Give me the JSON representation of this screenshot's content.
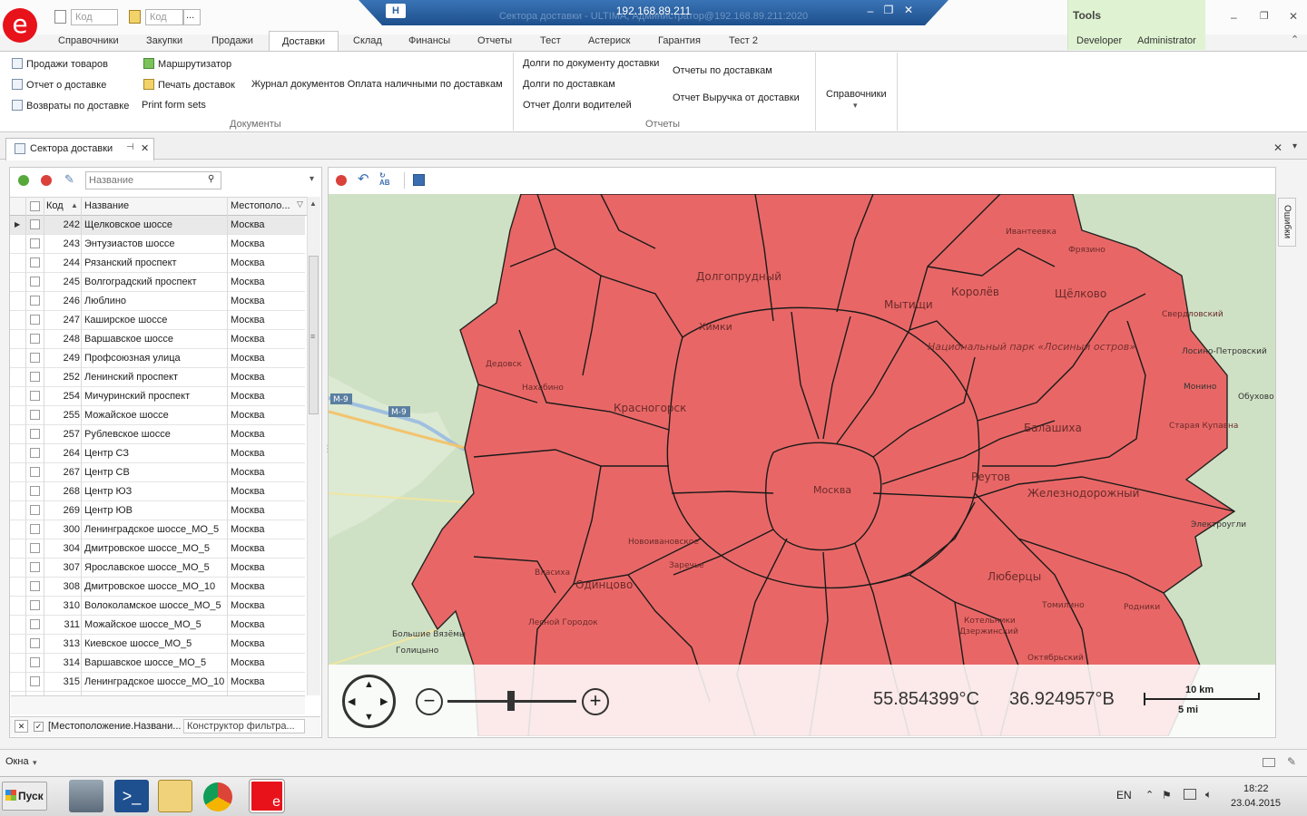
{
  "app": {
    "logo_letter": "e",
    "title_ip": "192.168.89.211",
    "title_full": "Сектора доставки - ULTIMA, Администратор@192.168.89.211:2020",
    "quick_code_1": "Код",
    "quick_code_2": "Код",
    "quick_more": "...",
    "accent_color": "#e8121b",
    "title_bar_color": "#2a62a3"
  },
  "tabs": [
    "Справочники",
    "Закупки",
    "Продажи",
    "Доставки",
    "Склад",
    "Финансы",
    "Отчеты",
    "Тест",
    "Астериск",
    "Гарантия",
    "Тест 2"
  ],
  "tools": {
    "label": "Tools",
    "items": [
      "Developer",
      "Administrator"
    ]
  },
  "ribbon": {
    "documents": {
      "label": "Документы",
      "items": [
        "Продажи товаров",
        "Отчет о доставке",
        "Возвраты по доставке",
        "Маршрутизатор",
        "Печать доставок",
        "Print form sets",
        "Журнал документов Оплата наличными по доставкам"
      ]
    },
    "reports": {
      "label": "Отчеты",
      "items": [
        "Долги по документу доставки",
        "Долги по доставкам",
        "Отчет Долги водителей",
        "Отчеты по доставкам",
        "Отчет Выручка от доставки"
      ]
    },
    "directories": {
      "label": "Справочники",
      "arrow": "▾"
    }
  },
  "doc_tab": {
    "title": "Сектора доставки",
    "pin_glyph": "⊣",
    "close_glyph": "✕"
  },
  "left_panel": {
    "search_placeholder": "Название",
    "columns": {
      "code": "Код",
      "name": "Название",
      "location": "Местополо..."
    },
    "rows": [
      {
        "code": "242",
        "name": "Щелковское шоссе",
        "location": "Москва"
      },
      {
        "code": "243",
        "name": "Энтузиастов шоссе",
        "location": "Москва"
      },
      {
        "code": "244",
        "name": "Рязанский проспект",
        "location": "Москва"
      },
      {
        "code": "245",
        "name": "Волгоградский проспект",
        "location": "Москва"
      },
      {
        "code": "246",
        "name": "Люблино",
        "location": "Москва"
      },
      {
        "code": "247",
        "name": "Каширское шоссе",
        "location": "Москва"
      },
      {
        "code": "248",
        "name": "Варшавское шоссе",
        "location": "Москва"
      },
      {
        "code": "249",
        "name": "Профсоюзная улица",
        "location": "Москва"
      },
      {
        "code": "252",
        "name": "Ленинский проспект",
        "location": "Москва"
      },
      {
        "code": "254",
        "name": "Мичуринский проспект",
        "location": "Москва"
      },
      {
        "code": "255",
        "name": "Можайское шоссе",
        "location": "Москва"
      },
      {
        "code": "257",
        "name": "Рублевское шоссе",
        "location": "Москва"
      },
      {
        "code": "264",
        "name": "Центр СЗ",
        "location": "Москва"
      },
      {
        "code": "267",
        "name": "Центр СВ",
        "location": "Москва"
      },
      {
        "code": "268",
        "name": "Центр ЮЗ",
        "location": "Москва"
      },
      {
        "code": "269",
        "name": "Центр ЮВ",
        "location": "Москва"
      },
      {
        "code": "300",
        "name": "Ленинградское шоссе_МО_5",
        "location": "Москва"
      },
      {
        "code": "304",
        "name": "Дмитровское шоссе_МО_5",
        "location": "Москва"
      },
      {
        "code": "307",
        "name": "Ярославское шоссе_МО_5",
        "location": "Москва"
      },
      {
        "code": "308",
        "name": "Дмитровское шоссе_МО_10",
        "location": "Москва"
      },
      {
        "code": "310",
        "name": "Волоколамское шоссе_МО_5",
        "location": "Москва"
      },
      {
        "code": "311",
        "name": "Можайское шоссе_МО_5",
        "location": "Москва"
      },
      {
        "code": "313",
        "name": "Киевское шоссе_МО_5",
        "location": "Москва"
      },
      {
        "code": "314",
        "name": "Варшавское шоссе_МО_5",
        "location": "Москва"
      },
      {
        "code": "315",
        "name": "Ленинградское шоссе_МО_10",
        "location": "Москва"
      }
    ],
    "filter_text": "[Местоположение.Названи...",
    "filter_builder": "Конструктор фильтра..."
  },
  "map": {
    "latitude": "55.854399°С",
    "longitude": "36.924957°В",
    "scale_km": "10 km",
    "scale_mi": "5 mi",
    "errors_tab": "Ошибки",
    "sector_color": "#ea5a5c",
    "labels": [
      "Долгопрудный",
      "Химки",
      "Мытищи",
      "Королёв",
      "Щёлково",
      "Красногорск",
      "Балашиха",
      "Реутов",
      "Москва",
      "Железнодорожный",
      "Одинцово",
      "Люберцы",
      "Дзержинский",
      "Лесной Городок",
      "Новоивановское",
      "Заречье",
      "Власиха",
      "Ивантеевка",
      "Фрязино",
      "Свердловский",
      "Лосино-Петровский",
      "Монино",
      "Обухово",
      "Старая Купавна",
      "Электроугли",
      "Родники",
      "Томилино",
      "Котельники",
      "Октябрьский",
      "Большие Вязёмы",
      "Голицыно",
      "Нахабино",
      "Дедовск",
      "Национальный парк «Лосиный остров»",
      "М-9"
    ]
  },
  "status": {
    "windows_label": "Окна",
    "arrow": "▾"
  },
  "taskbar": {
    "start_label": "Пуск",
    "lang": "EN",
    "time": "18:22",
    "date": "23.04.2015",
    "up_glyph": "⌃"
  }
}
